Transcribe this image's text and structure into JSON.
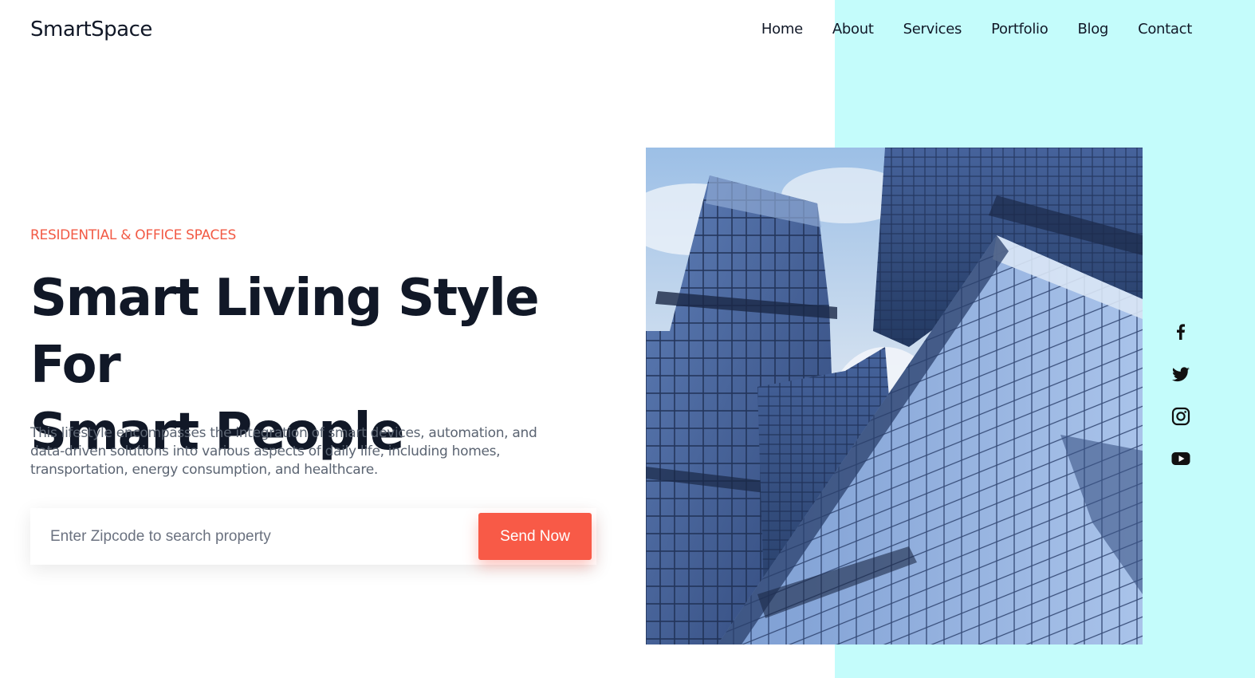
{
  "brand": {
    "name": "SmartSpace"
  },
  "nav": {
    "items": [
      {
        "label": "Home"
      },
      {
        "label": "About"
      },
      {
        "label": "Services"
      },
      {
        "label": "Portfolio"
      },
      {
        "label": "Blog"
      },
      {
        "label": "Contact"
      }
    ]
  },
  "hero": {
    "eyebrow": "RESIDENTIAL & OFFICE SPACES",
    "title_line1": "Smart Living Style For",
    "title_line2": "Smart People",
    "description": "This lifestyle encompasses the integration of smart devices, automation, and data-driven solutions into various aspects of daily life, including homes, transportation, energy consumption, and healthcare.",
    "search": {
      "placeholder": "Enter Zipcode to search property",
      "value": "",
      "button_label": "Send Now"
    },
    "image": {
      "subject": "glass skyscrapers viewed from below"
    }
  },
  "social": {
    "icons": [
      "facebook-icon",
      "twitter-icon",
      "instagram-icon",
      "youtube-icon"
    ]
  },
  "colors": {
    "accent": "#f85a47",
    "heading": "#111827",
    "body_text": "#5b6472",
    "side_panel": "#c4fcfb"
  }
}
